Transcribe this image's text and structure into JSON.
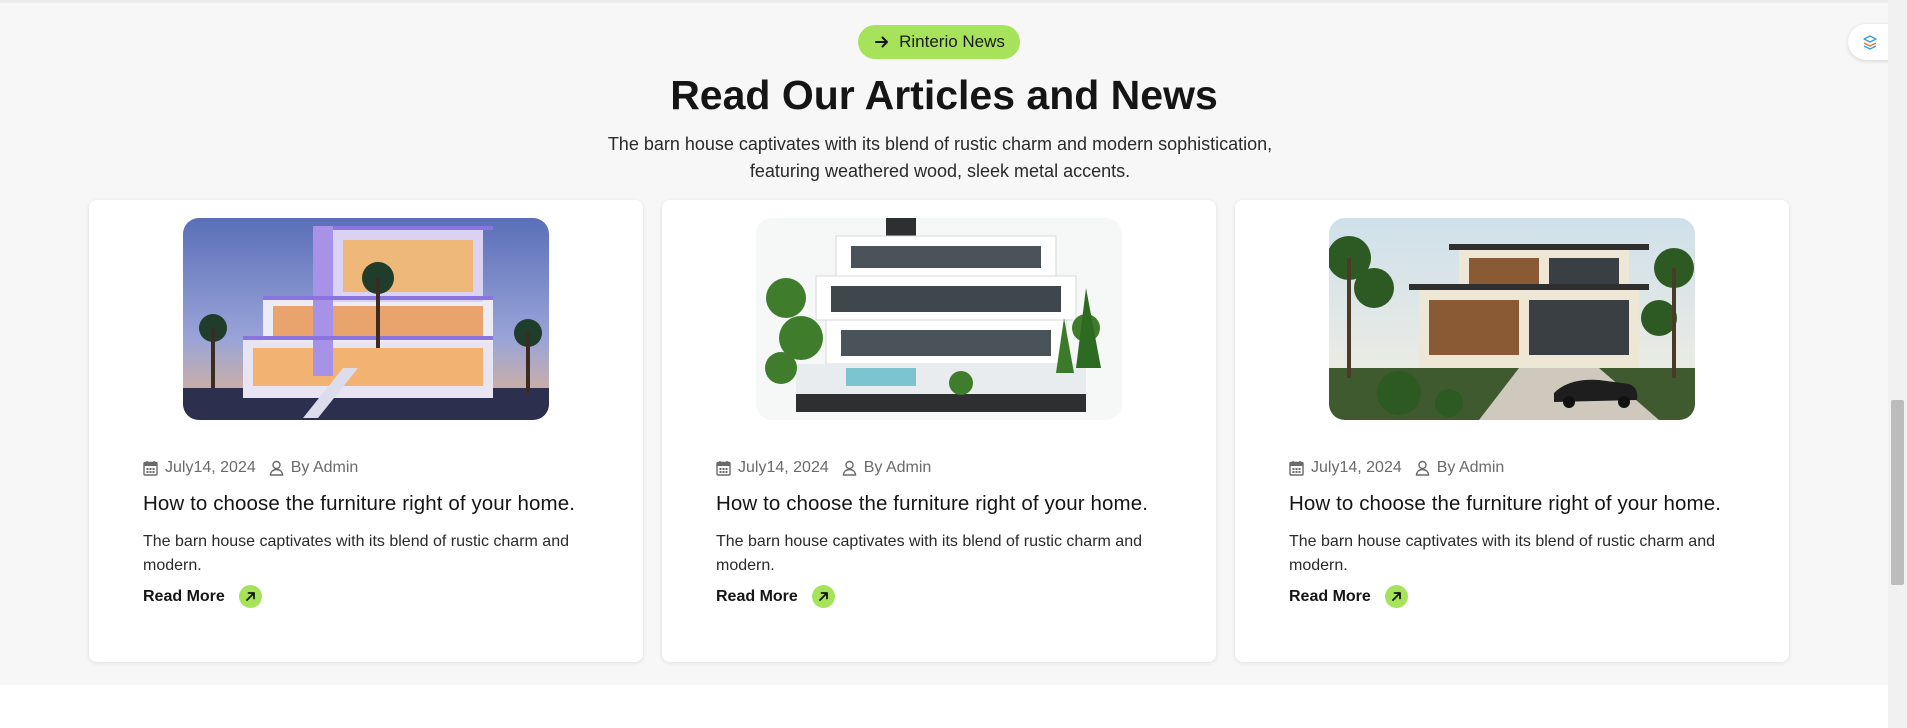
{
  "section": {
    "badge_label": "Rinterio News",
    "heading": "Read Our Articles and News",
    "subtitle": "The barn house captivates with its blend of rustic charm and modern sophistication, featuring weathered wood, sleek metal accents."
  },
  "accent_color": "#a6e35a",
  "cards": [
    {
      "date": "July14, 2024",
      "author": "By Admin",
      "title": "How to choose the furniture right of your home.",
      "text": "The barn house captivates with its blend of rustic charm and modern.",
      "read_more": "Read More",
      "image_alt": "modern villa with purple lights at dusk"
    },
    {
      "date": "July14, 2024",
      "author": "By Admin",
      "title": "How to choose the furniture right of your home.",
      "text": "The barn house captivates with its blend of rustic charm and modern.",
      "read_more": "Read More",
      "image_alt": "white modern house with greenery and pool"
    },
    {
      "date": "July14, 2024",
      "author": "By Admin",
      "title": "How to choose the furniture right of your home.",
      "text": "The barn house captivates with its blend of rustic charm and modern.",
      "read_more": "Read More",
      "image_alt": "tropical modern house with palm trees and car"
    }
  ]
}
